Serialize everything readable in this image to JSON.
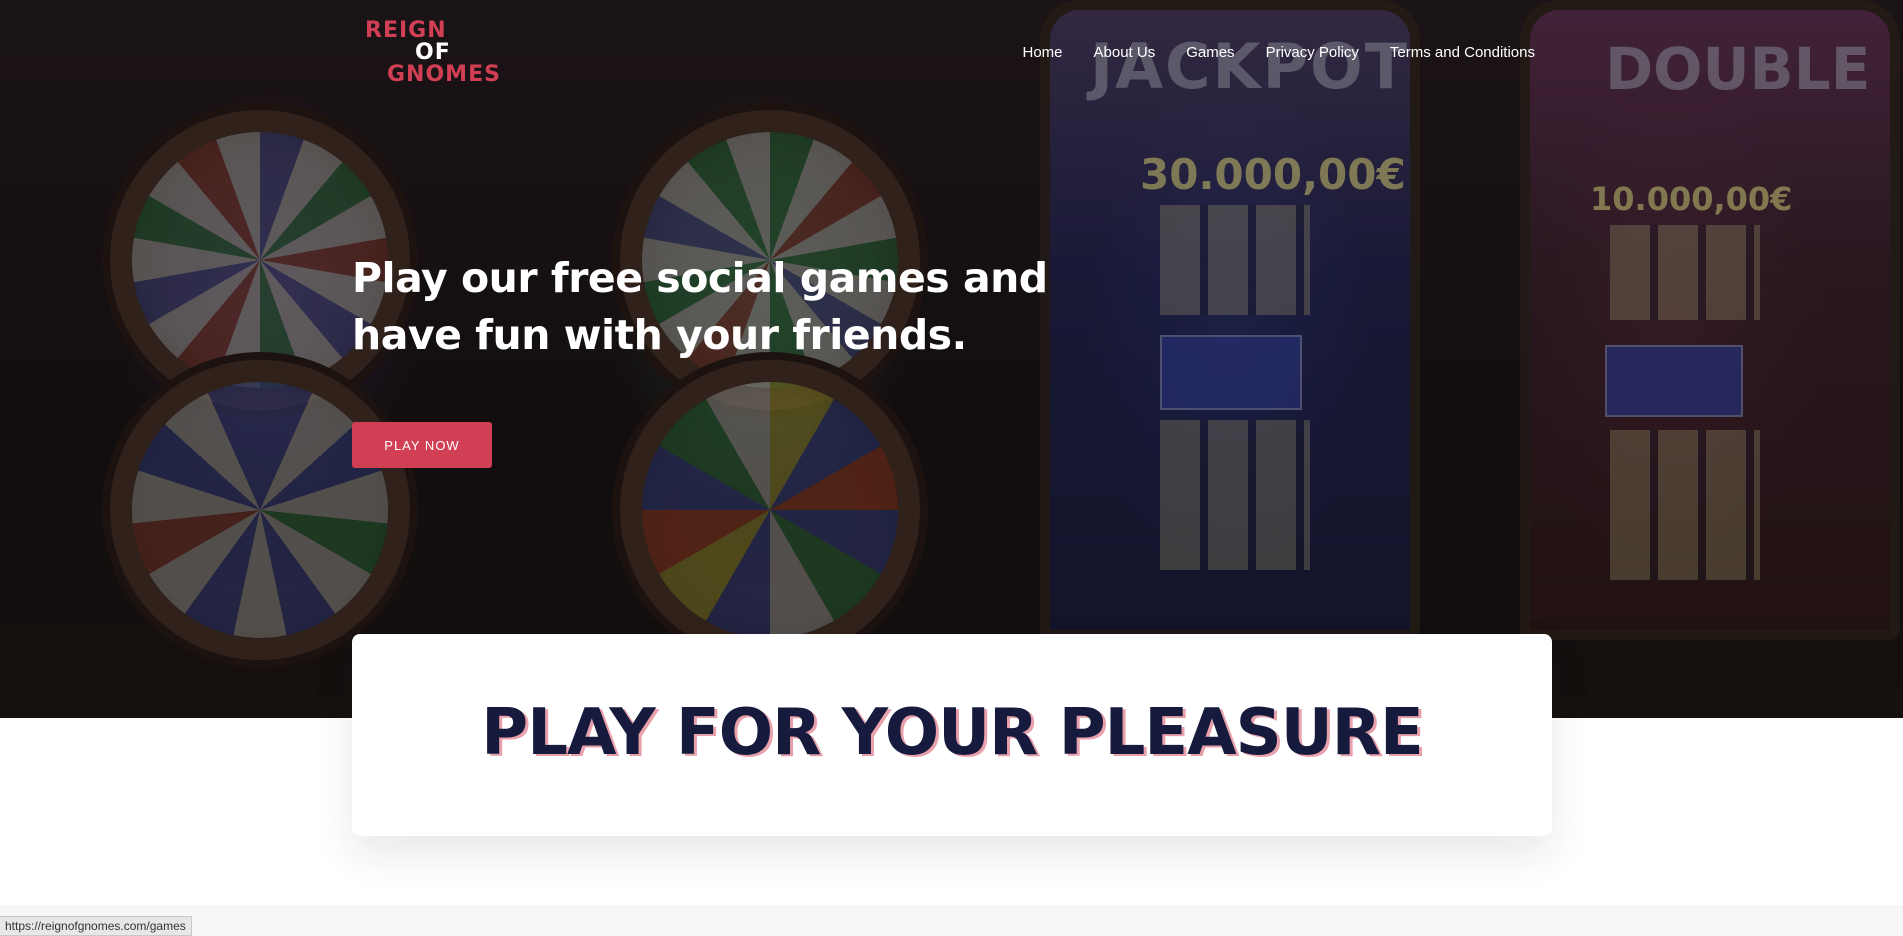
{
  "logo": {
    "line1": "REIGN",
    "line2": "OF",
    "line3": "GNOMES"
  },
  "nav": {
    "items": [
      {
        "label": "Home"
      },
      {
        "label": "About Us"
      },
      {
        "label": "Games"
      },
      {
        "label": "Privacy Policy"
      },
      {
        "label": "Terms and Conditions"
      }
    ]
  },
  "hero": {
    "headline_line1": "Play our free social games and",
    "headline_line2": "have fun with your friends.",
    "cta_label": "PLAY NOW",
    "background_art": {
      "sign_left": "JACKPOT",
      "sign_right": "DOUBLE",
      "amount_left": "30.000,00€",
      "amount_right": "10.000,00€"
    }
  },
  "section": {
    "title": "PLAY FOR YOUR PLEASURE"
  },
  "status_bar": {
    "url": "https://reignofgnomes.com/games"
  },
  "colors": {
    "accent": "#d13f55",
    "heading": "#161a3d",
    "white": "#ffffff"
  }
}
